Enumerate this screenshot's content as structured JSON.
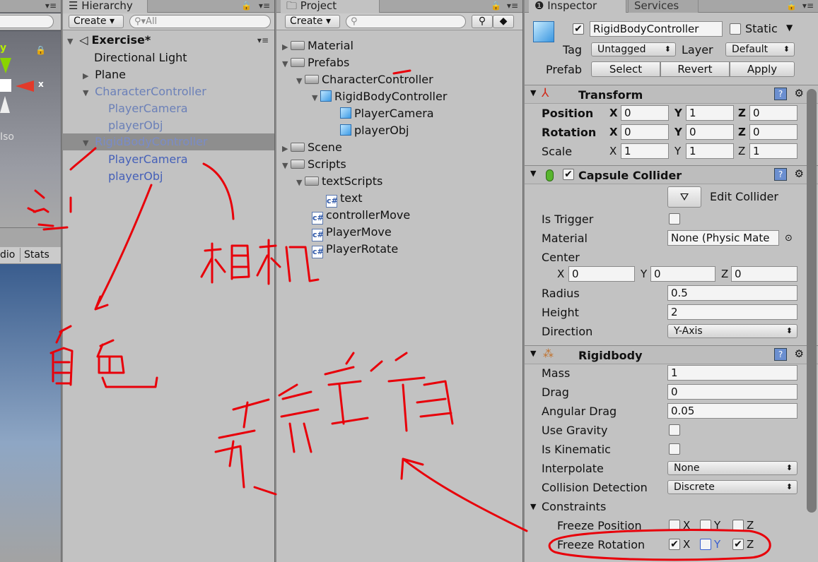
{
  "scene_panel": {
    "axis_y": "y",
    "axis_x": "x",
    "iso_label": "Iso",
    "audio_tab": "dio",
    "stats_tab": "Stats"
  },
  "hierarchy": {
    "tab_label": "Hierarchy",
    "create_label": "Create ▾",
    "search_placeholder": "All",
    "scene_name": "Exercise*",
    "rows": [
      "Directional Light",
      "Plane",
      "CharacterController",
      "PlayerCamera",
      "playerObj",
      "RigidBodyController",
      "PlayerCamera",
      "playerObj"
    ]
  },
  "project": {
    "tab_label": "Project",
    "create_label": "Create ▾",
    "rows": [
      "Material",
      "Prefabs",
      "CharacterController",
      "RigidBodyController",
      "PlayerCamera",
      "playerObj",
      "Scene",
      "Scripts",
      "textScripts",
      "text",
      "controllerMove",
      "PlayerMove",
      "PlayerRotate"
    ]
  },
  "inspector": {
    "tab_label": "Inspector",
    "services_tab": "Services",
    "object_name": "RigidBodyController",
    "static_label": "Static",
    "tag_label": "Tag",
    "tag_value": "Untagged",
    "layer_label": "Layer",
    "layer_value": "Default",
    "prefab_label": "Prefab",
    "select_btn": "Select",
    "revert_btn": "Revert",
    "apply_btn": "Apply",
    "transform": {
      "title": "Transform",
      "position_label": "Position",
      "rotation_label": "Rotation",
      "scale_label": "Scale",
      "position": [
        "0",
        "1",
        "0"
      ],
      "rotation": [
        "0",
        "0",
        "0"
      ],
      "scale": [
        "1",
        "1",
        "1"
      ]
    },
    "capsule": {
      "title": "Capsule Collider",
      "edit_collider": "Edit Collider",
      "is_trigger_label": "Is Trigger",
      "material_label": "Material",
      "material_value": "None (Physic Mate",
      "center_label": "Center",
      "center": [
        "0",
        "0",
        "0"
      ],
      "radius_label": "Radius",
      "radius": "0.5",
      "height_label": "Height",
      "height": "2",
      "direction_label": "Direction",
      "direction": "Y-Axis"
    },
    "rigidbody": {
      "title": "Rigidbody",
      "mass_label": "Mass",
      "mass": "1",
      "drag_label": "Drag",
      "drag": "0",
      "angular_drag_label": "Angular Drag",
      "angular_drag": "0.05",
      "use_gravity_label": "Use Gravity",
      "is_kinematic_label": "Is Kinematic",
      "interpolate_label": "Interpolate",
      "interpolate": "None",
      "collision_label": "Collision Detection",
      "collision": "Discrete",
      "constraints_label": "Constraints",
      "freeze_position_label": "Freeze Position",
      "freeze_rotation_label": "Freeze Rotation",
      "axis_x": "X",
      "axis_y": "Y",
      "axis_z": "Z"
    }
  },
  "colors": {
    "annotation": "#e8000a",
    "selection": "#8e8e8e",
    "prefab_blue": "#4560b8"
  }
}
